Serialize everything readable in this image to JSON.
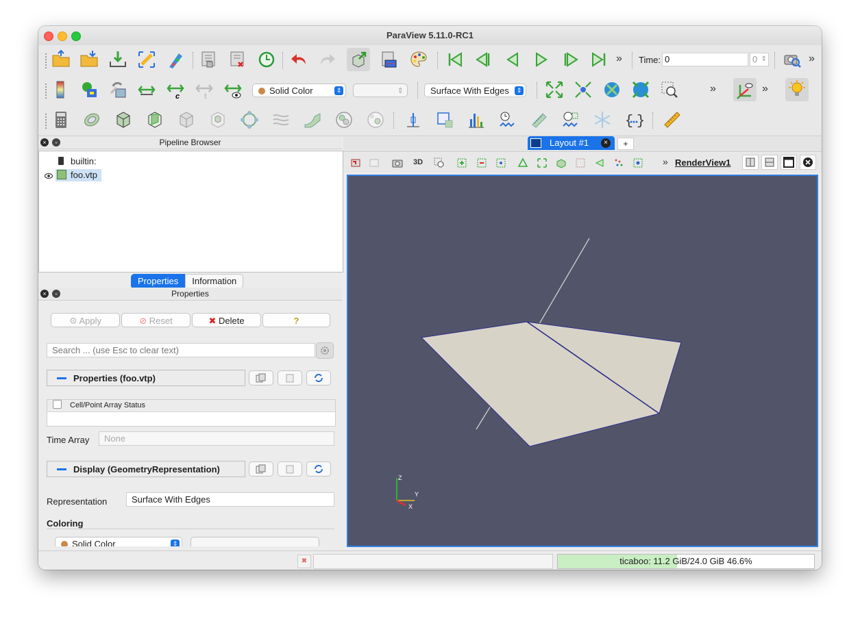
{
  "window": {
    "title": "ParaView 5.11.0-RC1"
  },
  "toolbar1": {
    "time_label": "Time:",
    "time_value": "0",
    "time_index": "0"
  },
  "toolbar2": {
    "color_mode": "Solid Color",
    "representation": "Surface With Edges"
  },
  "pipeline": {
    "title": "Pipeline Browser",
    "items": [
      {
        "label": "builtin:"
      },
      {
        "label": "foo.vtp"
      }
    ]
  },
  "tabs": {
    "properties": "Properties",
    "information": "Information"
  },
  "properties": {
    "title": "Properties",
    "apply": "Apply",
    "reset": "Reset",
    "delete": "Delete",
    "help": "?",
    "search_placeholder": "Search ... (use Esc to clear text)",
    "section_properties": "Properties (foo.vtp)",
    "array_status_header": "Cell/Point Array Status",
    "time_array_label": "Time Array",
    "time_array_value": "None",
    "section_display": "Display (GeometryRepresentation)",
    "representation_label": "Representation",
    "representation_value": "Surface With Edges",
    "coloring_label": "Coloring",
    "coloring_value": "Solid Color"
  },
  "layout": {
    "tab_label": "Layout #1",
    "add_tab": "+",
    "toolbar_3d": "3D",
    "view_name": "RenderView1"
  },
  "axes": {
    "z": "Z",
    "y": "Y",
    "x": "X"
  },
  "status": {
    "memory_text": "ticaboo: 11.2 GiB/24.0 GiB 46.6%",
    "memory_fraction": 0.466
  },
  "colors": {
    "accent": "#1a73e8",
    "viewport_bg": "#525569",
    "surface": "#d8d3c7",
    "memory_fill": "#c9eec3"
  }
}
